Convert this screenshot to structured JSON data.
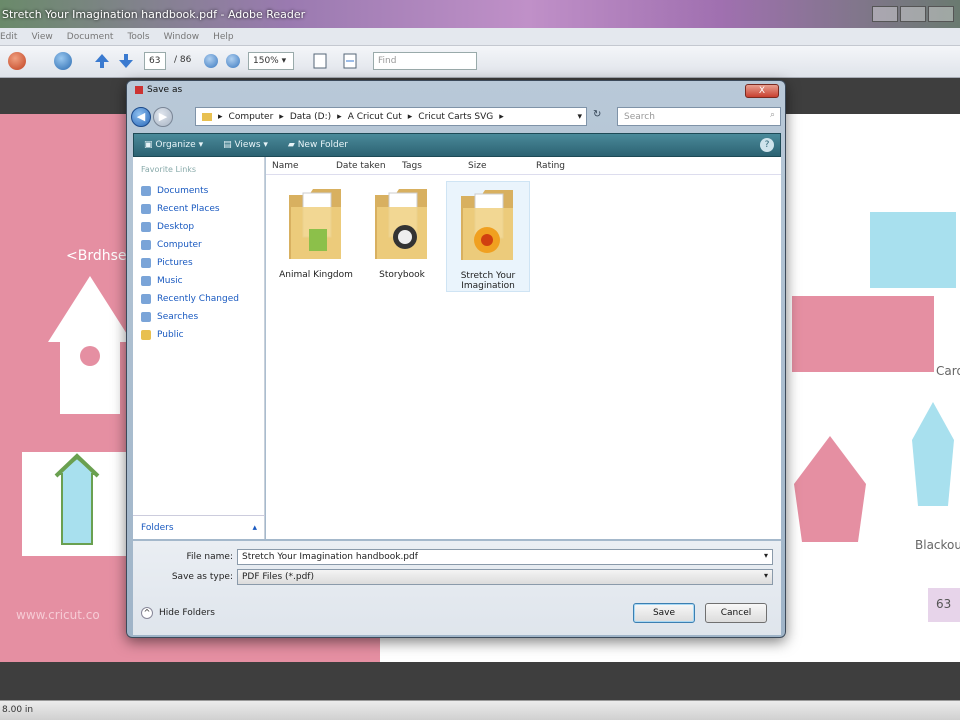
{
  "reader": {
    "title": "Stretch Your Imagination handbook.pdf - Adobe Reader",
    "menu": [
      "Edit",
      "View",
      "Document",
      "Tools",
      "Window",
      "Help"
    ],
    "page_current": "63",
    "page_total": "/ 86",
    "zoom": "150%",
    "find_placeholder": "Find",
    "status_text": "8.00 in"
  },
  "document": {
    "brd_text": "<Brdhse",
    "www_text": "www.cricut.co",
    "card_text": "Card",
    "blackout_text": "Blackout",
    "page_number": "63"
  },
  "dialog": {
    "title": "Save as",
    "close_label": "X",
    "path": [
      "Computer",
      "Data (D:)",
      "A Cricut Cut",
      "Cricut Carts SVG"
    ],
    "search_placeholder": "Search",
    "commands": {
      "organize": "Organize",
      "views": "Views",
      "new_folder": "New Folder",
      "help": "?"
    },
    "favorites_header": "Favorite Links",
    "favorites": [
      "Documents",
      "Recent Places",
      "Desktop",
      "Computer",
      "Pictures",
      "Music",
      "Recently Changed",
      "Searches",
      "Public"
    ],
    "folders_label": "Folders",
    "columns": [
      "Name",
      "Date taken",
      "Tags",
      "Size",
      "Rating"
    ],
    "files": [
      {
        "name": "Animal Kingdom",
        "color": "#8cc04a"
      },
      {
        "name": "Storybook",
        "color": "#333333"
      },
      {
        "name": "Stretch Your Imagination",
        "color": "#f0a020"
      }
    ],
    "file_name_label": "File name:",
    "file_name_value": "Stretch Your Imagination handbook.pdf",
    "save_type_label": "Save as type:",
    "save_type_value": "PDF Files (*.pdf)",
    "hide_folders": "Hide Folders",
    "save_button": "Save",
    "cancel_button": "Cancel"
  }
}
